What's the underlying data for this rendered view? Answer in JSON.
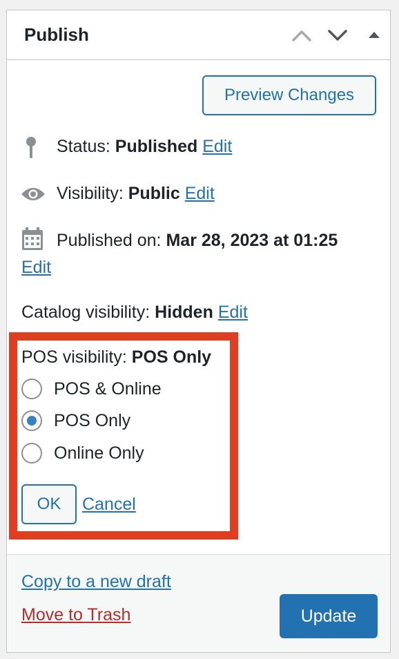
{
  "header": {
    "title": "Publish",
    "move_up_icon": "chevron-up-icon",
    "move_down_icon": "chevron-down-icon",
    "toggle_icon": "triangle-up-icon"
  },
  "preview_button": "Preview Changes",
  "status": {
    "label": "Status:",
    "value": "Published",
    "edit": "Edit",
    "icon": "pin-icon"
  },
  "visibility": {
    "label": "Visibility:",
    "value": "Public",
    "edit": "Edit",
    "icon": "eye-icon"
  },
  "published_on": {
    "label": "Published on:",
    "value": "Mar 28, 2023 at 01:25",
    "edit": "Edit",
    "icon": "calendar-icon"
  },
  "catalog_visibility": {
    "label": "Catalog visibility:",
    "value": "Hidden",
    "edit": "Edit"
  },
  "pos_visibility": {
    "label": "POS visibility:",
    "value": "POS Only",
    "options": [
      "POS & Online",
      "POS Only",
      "Online Only"
    ],
    "selected_index": 1,
    "ok": "OK",
    "cancel": "Cancel"
  },
  "footer": {
    "copy_draft": "Copy to a new draft",
    "trash": "Move to Trash",
    "update": "Update"
  },
  "colors": {
    "accent": "#2271b1",
    "highlight": "#e13d20",
    "trash": "#b32d2e",
    "radio_checked": "#3582c4"
  }
}
